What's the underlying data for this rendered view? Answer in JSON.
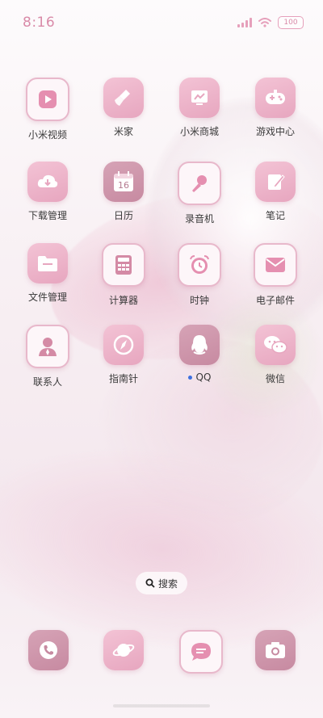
{
  "status_bar": {
    "time": "8:16",
    "battery": "100"
  },
  "apps": [
    {
      "label": "小米视频",
      "icon": "play-video-icon"
    },
    {
      "label": "米家",
      "icon": "broom-icon"
    },
    {
      "label": "小米商城",
      "icon": "store-screen-icon"
    },
    {
      "label": "游戏中心",
      "icon": "gamepad-icon"
    },
    {
      "label": "下载管理",
      "icon": "cloud-download-icon"
    },
    {
      "label": "日历",
      "icon": "calendar-icon",
      "calendar_day": "16"
    },
    {
      "label": "录音机",
      "icon": "microphone-icon"
    },
    {
      "label": "笔记",
      "icon": "note-pencil-icon"
    },
    {
      "label": "文件管理",
      "icon": "folder-icon"
    },
    {
      "label": "计算器",
      "icon": "calculator-icon"
    },
    {
      "label": "时钟",
      "icon": "alarm-clock-icon"
    },
    {
      "label": "电子邮件",
      "icon": "envelope-icon"
    },
    {
      "label": "联系人",
      "icon": "contact-person-icon"
    },
    {
      "label": "指南针",
      "icon": "compass-icon"
    },
    {
      "label": "QQ",
      "icon": "qq-penguin-icon",
      "new_dot": true
    },
    {
      "label": "微信",
      "icon": "wechat-bubbles-icon"
    }
  ],
  "search": {
    "label": "搜索"
  },
  "dock": [
    {
      "icon": "phone-icon"
    },
    {
      "icon": "browser-planet-icon"
    },
    {
      "icon": "messages-icon"
    },
    {
      "icon": "camera-icon"
    }
  ],
  "colors": {
    "accent_pink": "#e7a6bf",
    "mauve": "#c78aa1",
    "label_text": "#3a3a3a",
    "time_text": "#d98aa8",
    "notification_dot": "#3d6fe0"
  }
}
